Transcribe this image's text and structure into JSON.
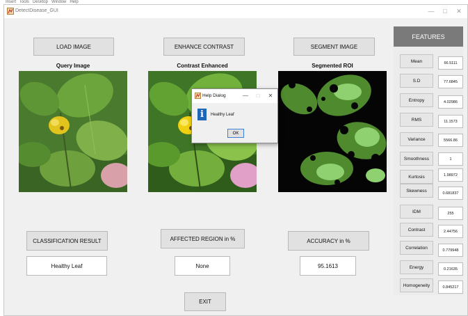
{
  "window": {
    "title": "DetectDisease_GUI",
    "minimize_glyph": "—",
    "maximize_glyph": "□",
    "close_glyph": "✕"
  },
  "menubar": {
    "items": [
      "Insert",
      "Tools",
      "Desktop",
      "Window",
      "Help"
    ]
  },
  "buttons": {
    "load_image": "LOAD IMAGE",
    "enhance_contrast": "ENHANCE CONTRAST",
    "segment_image": "SEGMENT IMAGE",
    "classification_result": "CLASSIFICATION RESULT",
    "affected_region": "AFFECTED REGION in %",
    "accuracy": "ACCURACY in %",
    "exit": "EXIT"
  },
  "captions": {
    "query": "Query Image",
    "enhanced": "Contrast Enhanced",
    "segmented": "Segmented ROI"
  },
  "results": {
    "classification": "Healthy Leaf",
    "affected_region": "None",
    "accuracy": "95.1613"
  },
  "features": {
    "header": "FEATURES",
    "items": [
      {
        "label": "Mean",
        "value": "66.5111"
      },
      {
        "label": "S.D",
        "value": "77.6845"
      },
      {
        "label": "Entropy",
        "value": "4.02986"
      },
      {
        "label": "RMS",
        "value": "11.1573"
      },
      {
        "label": "Variance",
        "value": "5566.86"
      },
      {
        "label": "Smoothness",
        "value": "1"
      },
      {
        "label": "Kurtosis",
        "value": "1.98972"
      },
      {
        "label": "Skewness",
        "value": "0.681837"
      },
      {
        "label": "IDM",
        "value": "255"
      },
      {
        "label": "Contrast",
        "value": "2.44756"
      },
      {
        "label": "Correlation",
        "value": "0.779948"
      },
      {
        "label": "Energy",
        "value": "0.21635"
      },
      {
        "label": "Homogeneity",
        "value": "0.845217"
      }
    ]
  },
  "dialog": {
    "title": "Help Dialog",
    "message": "Healthy Leaf",
    "ok_label": "OK",
    "minimize_glyph": "—",
    "maximize_glyph": "□",
    "close_glyph": "✕"
  }
}
